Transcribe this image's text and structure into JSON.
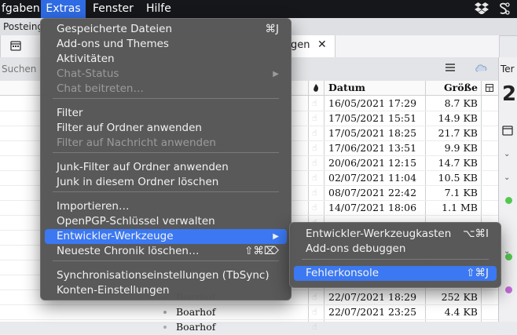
{
  "menubar": {
    "items": [
      "fgaben",
      "Extras",
      "Fenster",
      "Hilfe"
    ],
    "status_icons": [
      "dropbox-icon",
      "status-s-icon"
    ]
  },
  "toolbar": {
    "tab_left": "Posteing",
    "tab_right_label": "gen",
    "tab_close": "✕",
    "calendar_label": "Ter",
    "calendar_day": "2"
  },
  "search": {
    "placeholder": "Suchen <"
  },
  "columns": {
    "date": "Datum",
    "size": "Größe"
  },
  "rows": [
    {
      "date": "16/05/2021 17:29",
      "size": "8.7 KB",
      "from": ""
    },
    {
      "date": "17/05/2021 15:51",
      "size": "14.9 KB",
      "from": ""
    },
    {
      "date": "17/05/2021 18:25",
      "size": "21.7 KB",
      "from": ""
    },
    {
      "date": "17/06/2021 13:51",
      "size": "9.9 KB",
      "from": ""
    },
    {
      "date": "20/06/2021 12:15",
      "size": "14.7 KB",
      "from": ""
    },
    {
      "date": "02/07/2021 11:04",
      "size": "10.5 KB",
      "from": ""
    },
    {
      "date": "08/07/2021 22:42",
      "size": "7.1 KB",
      "from": ""
    },
    {
      "date": "14/07/2021 18:06",
      "size": "1.1 MB",
      "from": ""
    },
    {
      "date": "",
      "size": "",
      "from": ""
    },
    {
      "date": "",
      "size": "",
      "from": ""
    },
    {
      "date": "",
      "size": "",
      "from": ""
    },
    {
      "date": "",
      "size": "",
      "from": ""
    },
    {
      "date": "",
      "size": "",
      "from": ""
    },
    {
      "date": "22/07/2021 18:29",
      "size": "252 KB",
      "from": "Boarhof"
    },
    {
      "date": "22/07/2021 23:25",
      "size": "4.4 KB",
      "from": "Boarhof"
    },
    {
      "date": "",
      "size": "",
      "from": "Boarhof"
    }
  ],
  "extras_menu": {
    "items": [
      {
        "label": "Gespeicherte Dateien",
        "shortcut": "⌘J",
        "disabled": false
      },
      {
        "label": "Add-ons und Themes",
        "shortcut": "",
        "disabled": false
      },
      {
        "label": "Aktivitäten",
        "shortcut": "",
        "disabled": false
      },
      {
        "label": "Chat-Status",
        "shortcut": "▶",
        "disabled": true
      },
      {
        "label": "Chat beitreten…",
        "shortcut": "",
        "disabled": true
      },
      {
        "label": "Filter",
        "shortcut": "",
        "disabled": false
      },
      {
        "label": "Filter auf Ordner anwenden",
        "shortcut": "",
        "disabled": false
      },
      {
        "label": "Filter auf Nachricht anwenden",
        "shortcut": "",
        "disabled": true
      },
      {
        "label": "Junk-Filter auf Ordner anwenden",
        "shortcut": "",
        "disabled": false
      },
      {
        "label": "Junk in diesem Ordner löschen",
        "shortcut": "",
        "disabled": false
      },
      {
        "label": "Importieren…",
        "shortcut": "",
        "disabled": false
      },
      {
        "label": "OpenPGP-Schlüssel verwalten",
        "shortcut": "",
        "disabled": false
      },
      {
        "label": "Entwickler-Werkzeuge",
        "shortcut": "▶",
        "disabled": false
      },
      {
        "label": "Neueste Chronik löschen…",
        "shortcut": "⇧⌘⌦",
        "disabled": false
      },
      {
        "label": "Synchronisationseinstellungen (TbSync)",
        "shortcut": "",
        "disabled": false
      },
      {
        "label": "Konten-Einstellungen",
        "shortcut": "",
        "disabled": false
      }
    ]
  },
  "dev_submenu": {
    "items": [
      {
        "label": "Entwickler-Werkzeugkasten",
        "shortcut": "⌥⌘I"
      },
      {
        "label": "Add-ons debuggen",
        "shortcut": ""
      },
      {
        "label": "Fehlerkonsole",
        "shortcut": "⇧⌘J"
      }
    ]
  },
  "colors": {
    "accent": "#3b78f2",
    "menu_bg": "#565656",
    "menubar_bg": "#16171b"
  }
}
